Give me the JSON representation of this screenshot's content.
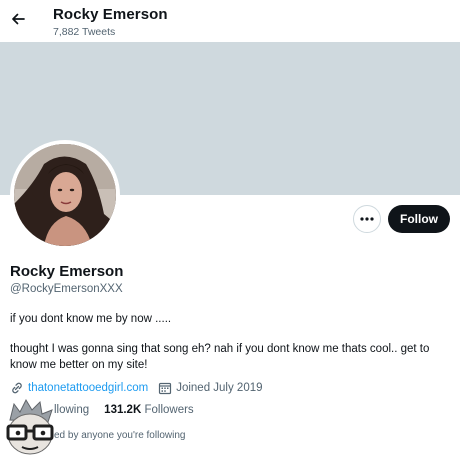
{
  "header": {
    "title": "Rocky Emerson",
    "tweet_count": "7,882 Tweets"
  },
  "actions": {
    "more_icon": "ellipsis-icon",
    "follow_label": "Follow"
  },
  "profile": {
    "name": "Rocky Emerson",
    "handle": "@RockyEmersonXXX",
    "bio_line1": "if you dont know me by now .....",
    "bio_line2": "thought I was gonna sing that song eh? nah if you dont know me thats cool.. get to know me better on my site!",
    "website": "thatonetattooedgirl.com",
    "joined": "Joined July 2019"
  },
  "stats": {
    "following_label": "llowing",
    "followers_count": "131.2K",
    "followers_label": "Followers"
  },
  "followed_by": "ed by anyone you're following",
  "colors": {
    "banner": "#cfd9de",
    "link": "#1d9bf0",
    "secondary_text": "#536471",
    "button_dark": "#0f1419"
  }
}
